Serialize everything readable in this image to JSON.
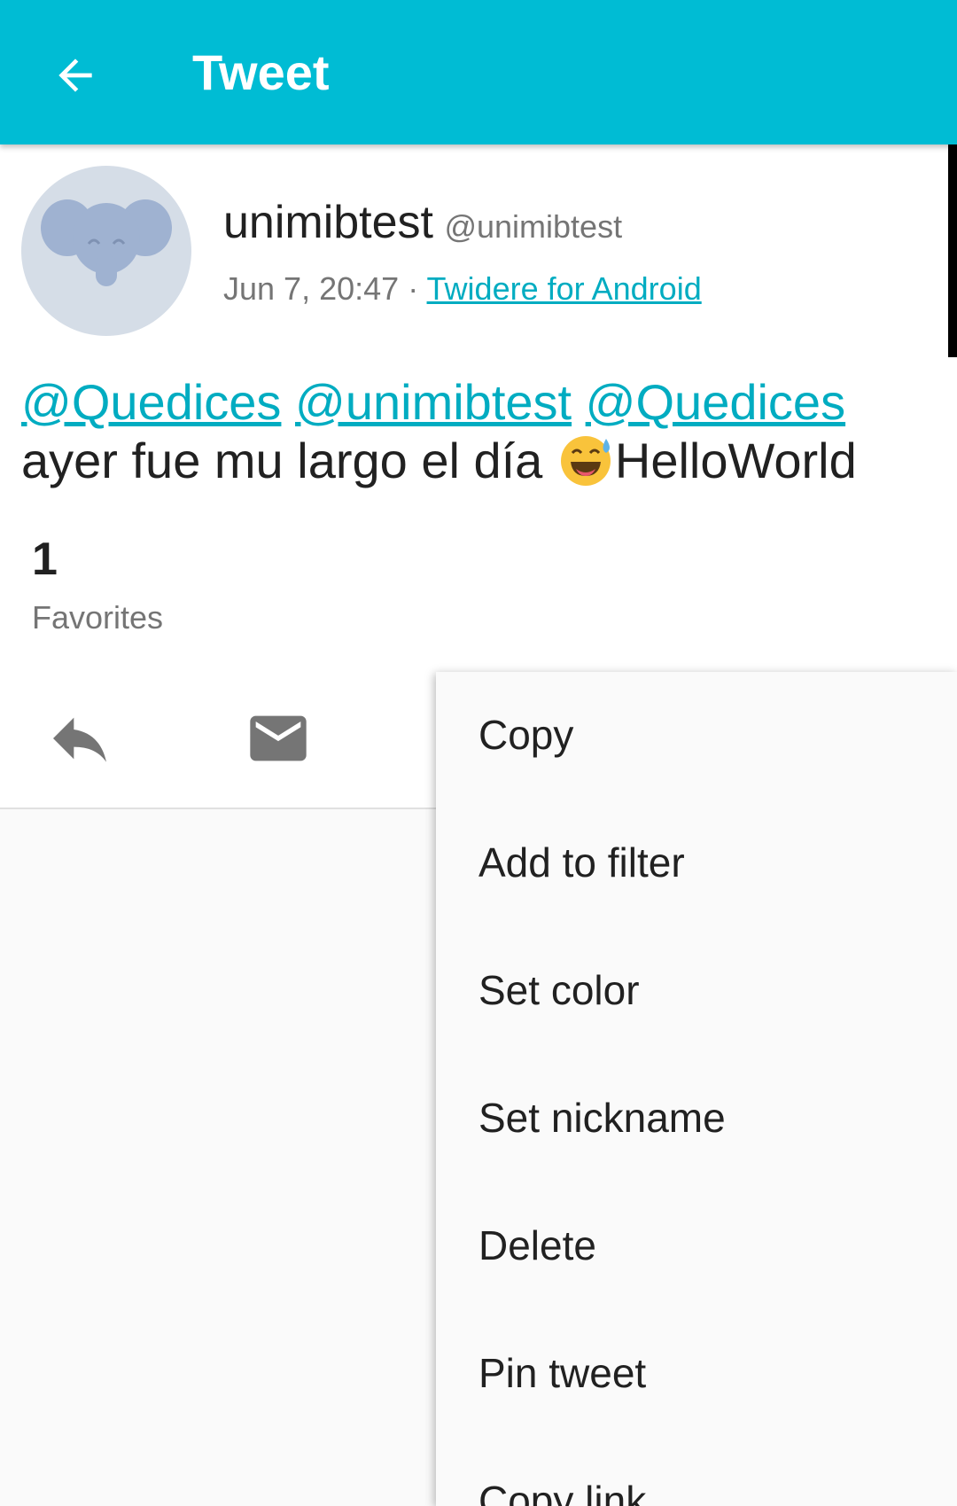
{
  "app_bar": {
    "title": "Tweet",
    "background_color": "#00bcd4",
    "back_icon": "arrow-left-icon"
  },
  "tweet": {
    "display_name": "unimibtest",
    "screen_name": "@unimibtest",
    "timestamp": "Jun 7, 20:47",
    "separator": "·",
    "source": "Twidere for Android",
    "mentions": [
      "@Quedices",
      "@unimibtest",
      "@Quedices"
    ],
    "text_before_emoji": "ayer fue mu largo el día",
    "emoji": "grinning-face-with-sweat",
    "text_after_emoji": "HelloWorld",
    "avatar_icon": "elephant-avatar",
    "link_color": "#00acc1"
  },
  "stats": {
    "favorites_count": "1",
    "favorites_label": "Favorites"
  },
  "actions": {
    "reply_icon": "reply-icon",
    "direct_message_icon": "mail-icon"
  },
  "context_menu": {
    "items": [
      {
        "label": "Copy"
      },
      {
        "label": "Add to filter"
      },
      {
        "label": "Set color"
      },
      {
        "label": "Set nickname"
      },
      {
        "label": "Delete"
      },
      {
        "label": "Pin tweet"
      },
      {
        "label": "Copy link"
      }
    ]
  }
}
